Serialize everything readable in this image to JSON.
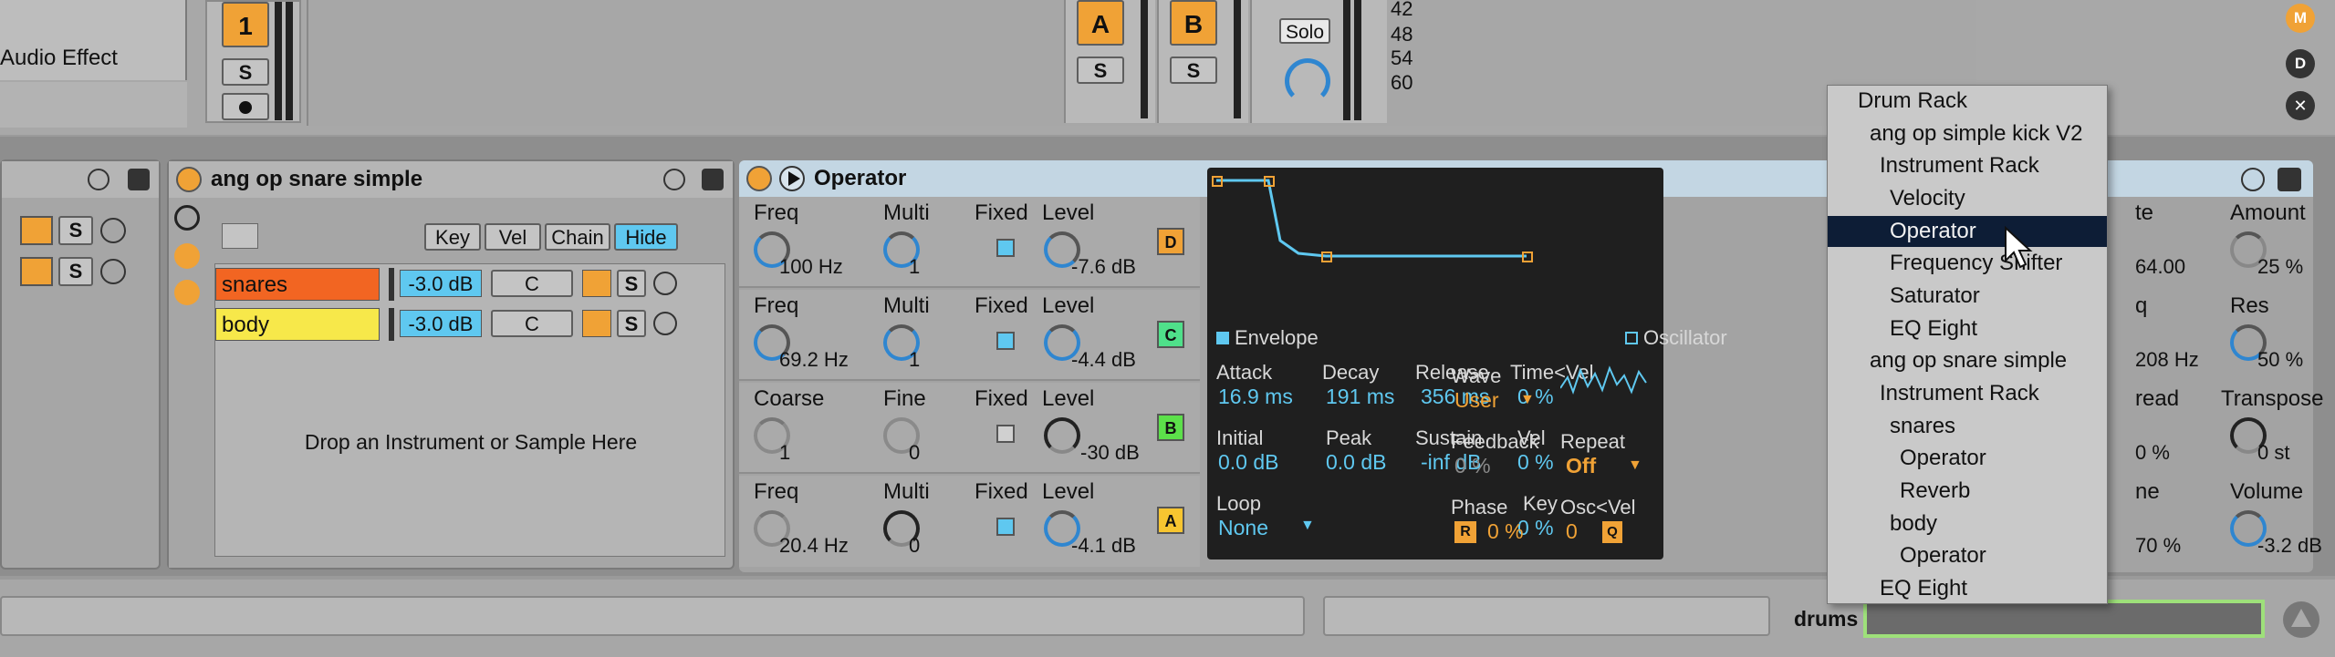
{
  "mixer": {
    "audio_effect_label": "Audio Effect",
    "track1": {
      "number": "1",
      "solo": "S"
    },
    "return_a": {
      "letter": "A",
      "solo": "S"
    },
    "return_b": {
      "letter": "B",
      "solo": "S"
    },
    "master": {
      "solo_label": "Solo",
      "db_marks": [
        "42",
        "48",
        "54",
        "60"
      ],
      "side_buttons": [
        "M",
        "D"
      ]
    }
  },
  "chain_left": {
    "solo": "S"
  },
  "drum_rack": {
    "title": "ang op snare simple",
    "buttons": {
      "key": "Key",
      "vel": "Vel",
      "chain": "Chain",
      "hide": "Hide"
    },
    "chains": [
      {
        "name": "snares",
        "volume": "-3.0 dB",
        "pan": "C",
        "solo": "S",
        "color": "#f26522"
      },
      {
        "name": "body",
        "volume": "-3.0 dB",
        "pan": "C",
        "solo": "S",
        "color": "#f7e84a"
      }
    ],
    "drop_hint": "Drop an Instrument or Sample Here"
  },
  "operator": {
    "title": "Operator",
    "oscillators": [
      {
        "p1_label": "Freq",
        "p1_value": "100 Hz",
        "p2_label": "Multi",
        "p2_value": "1",
        "fixed_label": "Fixed",
        "level_label": "Level",
        "level_value": "-7.6 dB",
        "letter": "D",
        "letter_color": "#f0a236"
      },
      {
        "p1_label": "Freq",
        "p1_value": "69.2 Hz",
        "p2_label": "Multi",
        "p2_value": "1",
        "fixed_label": "Fixed",
        "level_label": "Level",
        "level_value": "-4.4 dB",
        "letter": "C",
        "letter_color": "#4fe08a"
      },
      {
        "p1_label": "Coarse",
        "p1_value": "1",
        "p2_label": "Fine",
        "p2_value": "0",
        "fixed_label": "Fixed",
        "level_label": "Level",
        "level_value": "-30 dB",
        "letter": "B",
        "letter_color": "#5ce04a"
      },
      {
        "p1_label": "Freq",
        "p1_value": "20.4 Hz",
        "p2_label": "Multi",
        "p2_value": "0",
        "fixed_label": "Fixed",
        "level_label": "Level",
        "level_value": "-4.1 dB",
        "letter": "A",
        "letter_color": "#f7c530"
      }
    ],
    "envelope": {
      "section_label": "Envelope",
      "attack_label": "Attack",
      "attack": "16.9 ms",
      "decay_label": "Decay",
      "decay": "191 ms",
      "release_label": "Release",
      "release": "356 ms",
      "time_vel_label": "Time<Vel",
      "time_vel": "0 %",
      "initial_label": "Initial",
      "initial": "0.0 dB",
      "peak_label": "Peak",
      "peak": "0.0 dB",
      "sustain_label": "Sustain",
      "sustain": "-inf dB",
      "vel_label": "Vel",
      "vel": "0 %",
      "loop_label": "Loop",
      "loop": "None",
      "key_label": "Key",
      "key": "0 %"
    },
    "oscillator_section": {
      "section_label": "Oscillator",
      "wave_label": "Wave",
      "wave": "User",
      "feedback_label": "Feedback",
      "feedback": "0 %",
      "repeat_label": "Repeat",
      "repeat": "Off",
      "phase_label": "Phase",
      "phase_r": "R",
      "phase": "0 %",
      "osc_vel_label": "Osc<Vel",
      "osc_vel": "0",
      "q_label": "Q"
    },
    "right_params": {
      "p1_label_partial": "te",
      "p1_value_partial": "64.00",
      "amount_label": "Amount",
      "amount_value": "25 %",
      "p2_label_partial": "q",
      "p2_value_partial": "208 Hz",
      "res_label": "Res",
      "res_value": "50 %",
      "p3_label_partial": "read",
      "p3_value_partial": "0 %",
      "transpose_label": "Transpose",
      "transpose_value": "0 st",
      "p4_label_partial": "ne",
      "p4_value_partial": "70 %",
      "volume_label": "Volume",
      "volume_value": "-3.2 dB"
    }
  },
  "context_menu": {
    "items": [
      {
        "label": "Drum Rack",
        "indent": 0,
        "selected": false
      },
      {
        "label": "ang op simple kick V2",
        "indent": 1,
        "selected": false
      },
      {
        "label": "Instrument Rack",
        "indent": 2,
        "selected": false
      },
      {
        "label": "Velocity",
        "indent": 3,
        "selected": false
      },
      {
        "label": "Operator",
        "indent": 3,
        "selected": true
      },
      {
        "label": "Frequency Shifter",
        "indent": 3,
        "selected": false
      },
      {
        "label": "Saturator",
        "indent": 3,
        "selected": false
      },
      {
        "label": "EQ Eight",
        "indent": 3,
        "selected": false
      },
      {
        "label": "ang op snare simple",
        "indent": 1,
        "selected": false
      },
      {
        "label": "Instrument Rack",
        "indent": 2,
        "selected": false
      },
      {
        "label": "snares",
        "indent": 3,
        "selected": false
      },
      {
        "label": "Operator",
        "indent": 4,
        "selected": false
      },
      {
        "label": "Reverb",
        "indent": 4,
        "selected": false
      },
      {
        "label": "body",
        "indent": 3,
        "selected": false
      },
      {
        "label": "Operator",
        "indent": 4,
        "selected": false
      },
      {
        "label": "EQ Eight",
        "indent": 2,
        "selected": false
      }
    ]
  },
  "bottom_bar": {
    "track_label": "drums"
  },
  "colors": {
    "accent_orange": "#f0a236",
    "accent_blue": "#5fc8f0",
    "selection_navy": "#0d1d36",
    "device_header": "#c3d6e3"
  }
}
